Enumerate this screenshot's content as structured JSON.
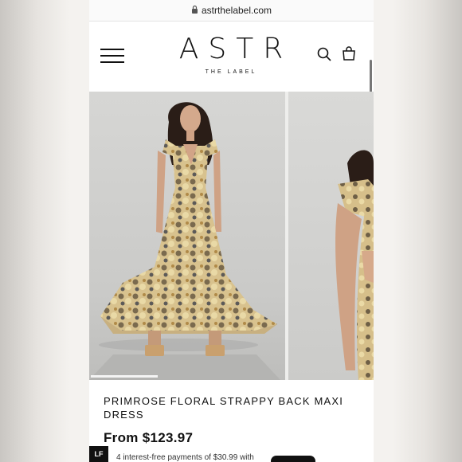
{
  "browser": {
    "url": "astrthelabel.com"
  },
  "header": {
    "logo_main": "ASTR",
    "logo_sub": "THE LABEL"
  },
  "product": {
    "title": "PRIMROSE FLORAL STRAPPY BACK MAXI DRESS",
    "price": "From $123.97",
    "installment_text": "4 interest-free payments of $30.99 with",
    "gallery_position": 0.33
  },
  "side_tab": {
    "label": "LF"
  },
  "icons": [
    "lock-icon",
    "hamburger-menu-icon",
    "search-icon",
    "shopping-bag-icon"
  ]
}
